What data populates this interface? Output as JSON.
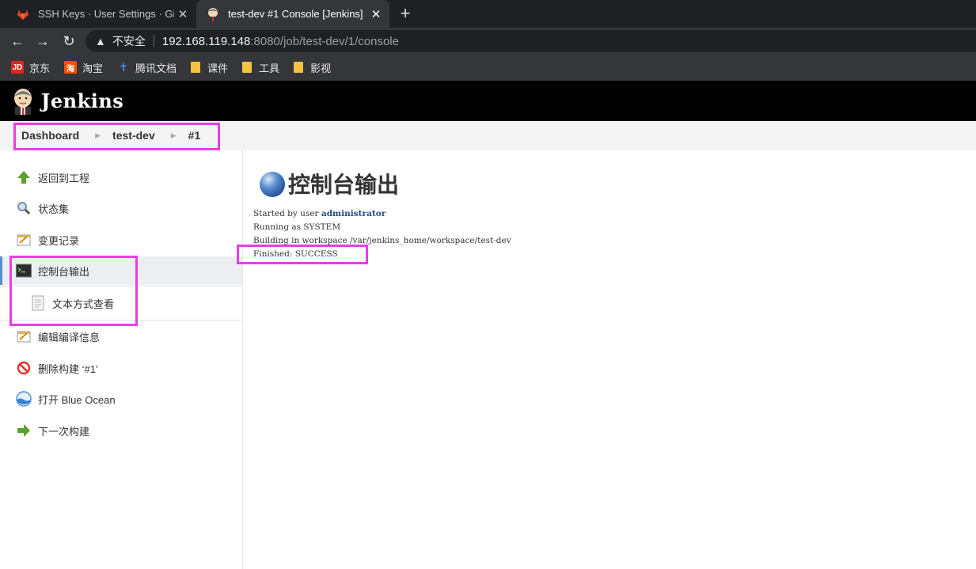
{
  "browser": {
    "tabs": [
      {
        "title": "SSH Keys · User Settings · GitLab",
        "favicon": "gitlab-icon",
        "active": false
      },
      {
        "title": "test-dev #1 Console [Jenkins]",
        "favicon": "jenkins-icon",
        "active": true
      }
    ],
    "new_tab": "+",
    "security_label": "不安全",
    "url_host": "192.168.119.148",
    "url_rest": ":8080/job/test-dev/1/console",
    "bookmarks": [
      {
        "label": "京东",
        "icon": "JD"
      },
      {
        "label": "淘宝",
        "icon": "淘"
      },
      {
        "label": "腾讯文档",
        "icon": "docs"
      },
      {
        "label": "课件",
        "icon": "folder"
      },
      {
        "label": "工具",
        "icon": "folder"
      },
      {
        "label": "影视",
        "icon": "folder"
      }
    ]
  },
  "jenkins": {
    "brand": "Jenkins",
    "breadcrumb": [
      "Dashboard",
      "test-dev",
      "#1"
    ],
    "tasks": [
      {
        "label": "返回到工程",
        "icon": "up-arrow-icon"
      },
      {
        "label": "状态集",
        "icon": "magnifier-icon"
      },
      {
        "label": "变更记录",
        "icon": "notepad-icon"
      },
      {
        "label": "控制台输出",
        "icon": "terminal-icon"
      },
      {
        "label": "文本方式查看",
        "icon": "document-icon"
      },
      {
        "label": "编辑编译信息",
        "icon": "notepad-icon"
      },
      {
        "label": "删除构建 ‘#1’",
        "icon": "no-entry-icon"
      },
      {
        "label": "打开 Blue Ocean",
        "icon": "blue-ocean-icon"
      },
      {
        "label": "下一次构建",
        "icon": "right-arrow-icon"
      }
    ],
    "page_title": "控制台输出",
    "console": {
      "line1_prefix": "Started by user ",
      "line1_user": "administrator",
      "line2": "Running as SYSTEM",
      "line3": "Building in workspace /var/jenkins_home/workspace/test-dev",
      "line4": "Finished: SUCCESS"
    }
  },
  "colors": {
    "highlight": "#e63ee6",
    "active_task_border": "#5a8dcc",
    "link": "#204a87"
  }
}
